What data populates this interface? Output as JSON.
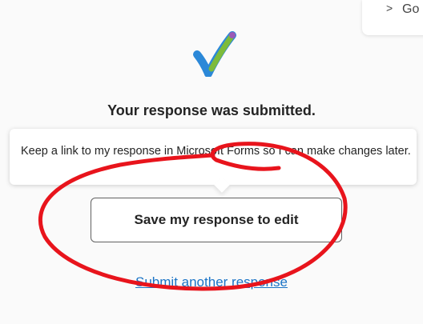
{
  "corner": {
    "chevron": ">",
    "text": "Go"
  },
  "form": {
    "title": "Your response was submitted.",
    "tooltip": "Keep a link to my response in Microsoft Forms so I can make changes later.",
    "save_button": "Save my response to edit",
    "submit_another_link": "Submit another response"
  },
  "colors": {
    "check_blue": "#2b88d8",
    "check_green": "#7dbb3b",
    "link": "#1a73c6",
    "annotation": "#e8141c"
  }
}
